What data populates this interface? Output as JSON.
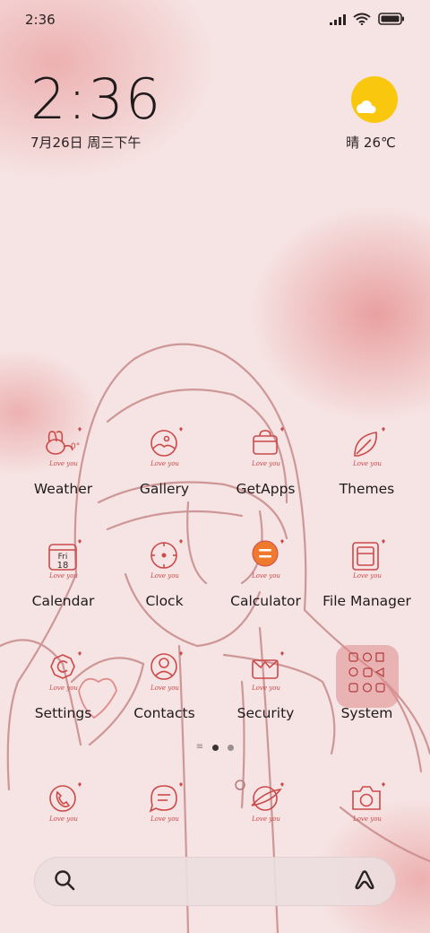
{
  "status_bar": {
    "time": "2:36"
  },
  "clock_widget": {
    "time": "2:36",
    "date": "7月26日 周三下午"
  },
  "weather_widget": {
    "text": "晴 26℃",
    "icon": "sun-cloud-icon"
  },
  "apps": [
    [
      {
        "label": "Weather",
        "icon": "weather-icon"
      },
      {
        "label": "Gallery",
        "icon": "gallery-icon"
      },
      {
        "label": "GetApps",
        "icon": "getapps-icon"
      },
      {
        "label": "Themes",
        "icon": "themes-icon"
      }
    ],
    [
      {
        "label": "Calendar",
        "icon": "calendar-icon",
        "day_name": "Fri",
        "day_number": "18"
      },
      {
        "label": "Clock",
        "icon": "clock-icon"
      },
      {
        "label": "Calculator",
        "icon": "calculator-icon"
      },
      {
        "label": "File Manager",
        "icon": "file-manager-icon"
      }
    ],
    [
      {
        "label": "Settings",
        "icon": "settings-icon"
      },
      {
        "label": "Contacts",
        "icon": "contacts-icon"
      },
      {
        "label": "Security",
        "icon": "security-icon"
      },
      {
        "label": "System",
        "icon": "folder-icon"
      }
    ]
  ],
  "dock": [
    {
      "icon": "phone-icon"
    },
    {
      "icon": "messages-icon"
    },
    {
      "icon": "browser-icon"
    },
    {
      "icon": "camera-icon"
    }
  ],
  "icon_caption": "Love you",
  "page_indicator": {
    "pages": 2,
    "active": 0
  },
  "colors": {
    "accent": "#cc4a4a",
    "calculator": "#ef7a2e",
    "sun": "#f9c80e"
  }
}
